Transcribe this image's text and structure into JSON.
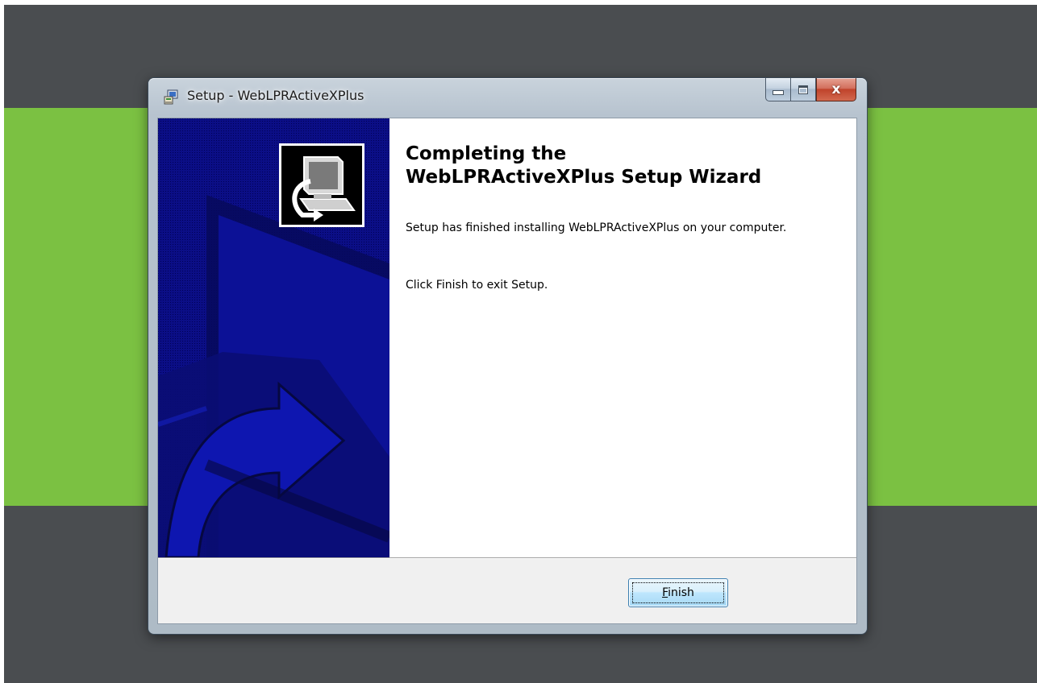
{
  "window": {
    "title": "Setup - WebLPRActiveXPlus",
    "close_glyph": "x"
  },
  "wizard": {
    "heading_line1": "Completing the",
    "heading_line2": "WebLPRActiveXPlus Setup Wizard",
    "finished_text": "Setup has finished installing WebLPRActiveXPlus on your computer.",
    "exit_hint": "Click Finish to exit Setup."
  },
  "buttons": {
    "finish_accel": "F",
    "finish_rest": "inish"
  },
  "icons": {
    "title": "setup-installer-icon",
    "wizard": "computer-install-icon"
  },
  "colors": {
    "desktop": "#4a4d50",
    "accent_band": "#7bc142",
    "wizard_panel": "#0b0e86"
  }
}
